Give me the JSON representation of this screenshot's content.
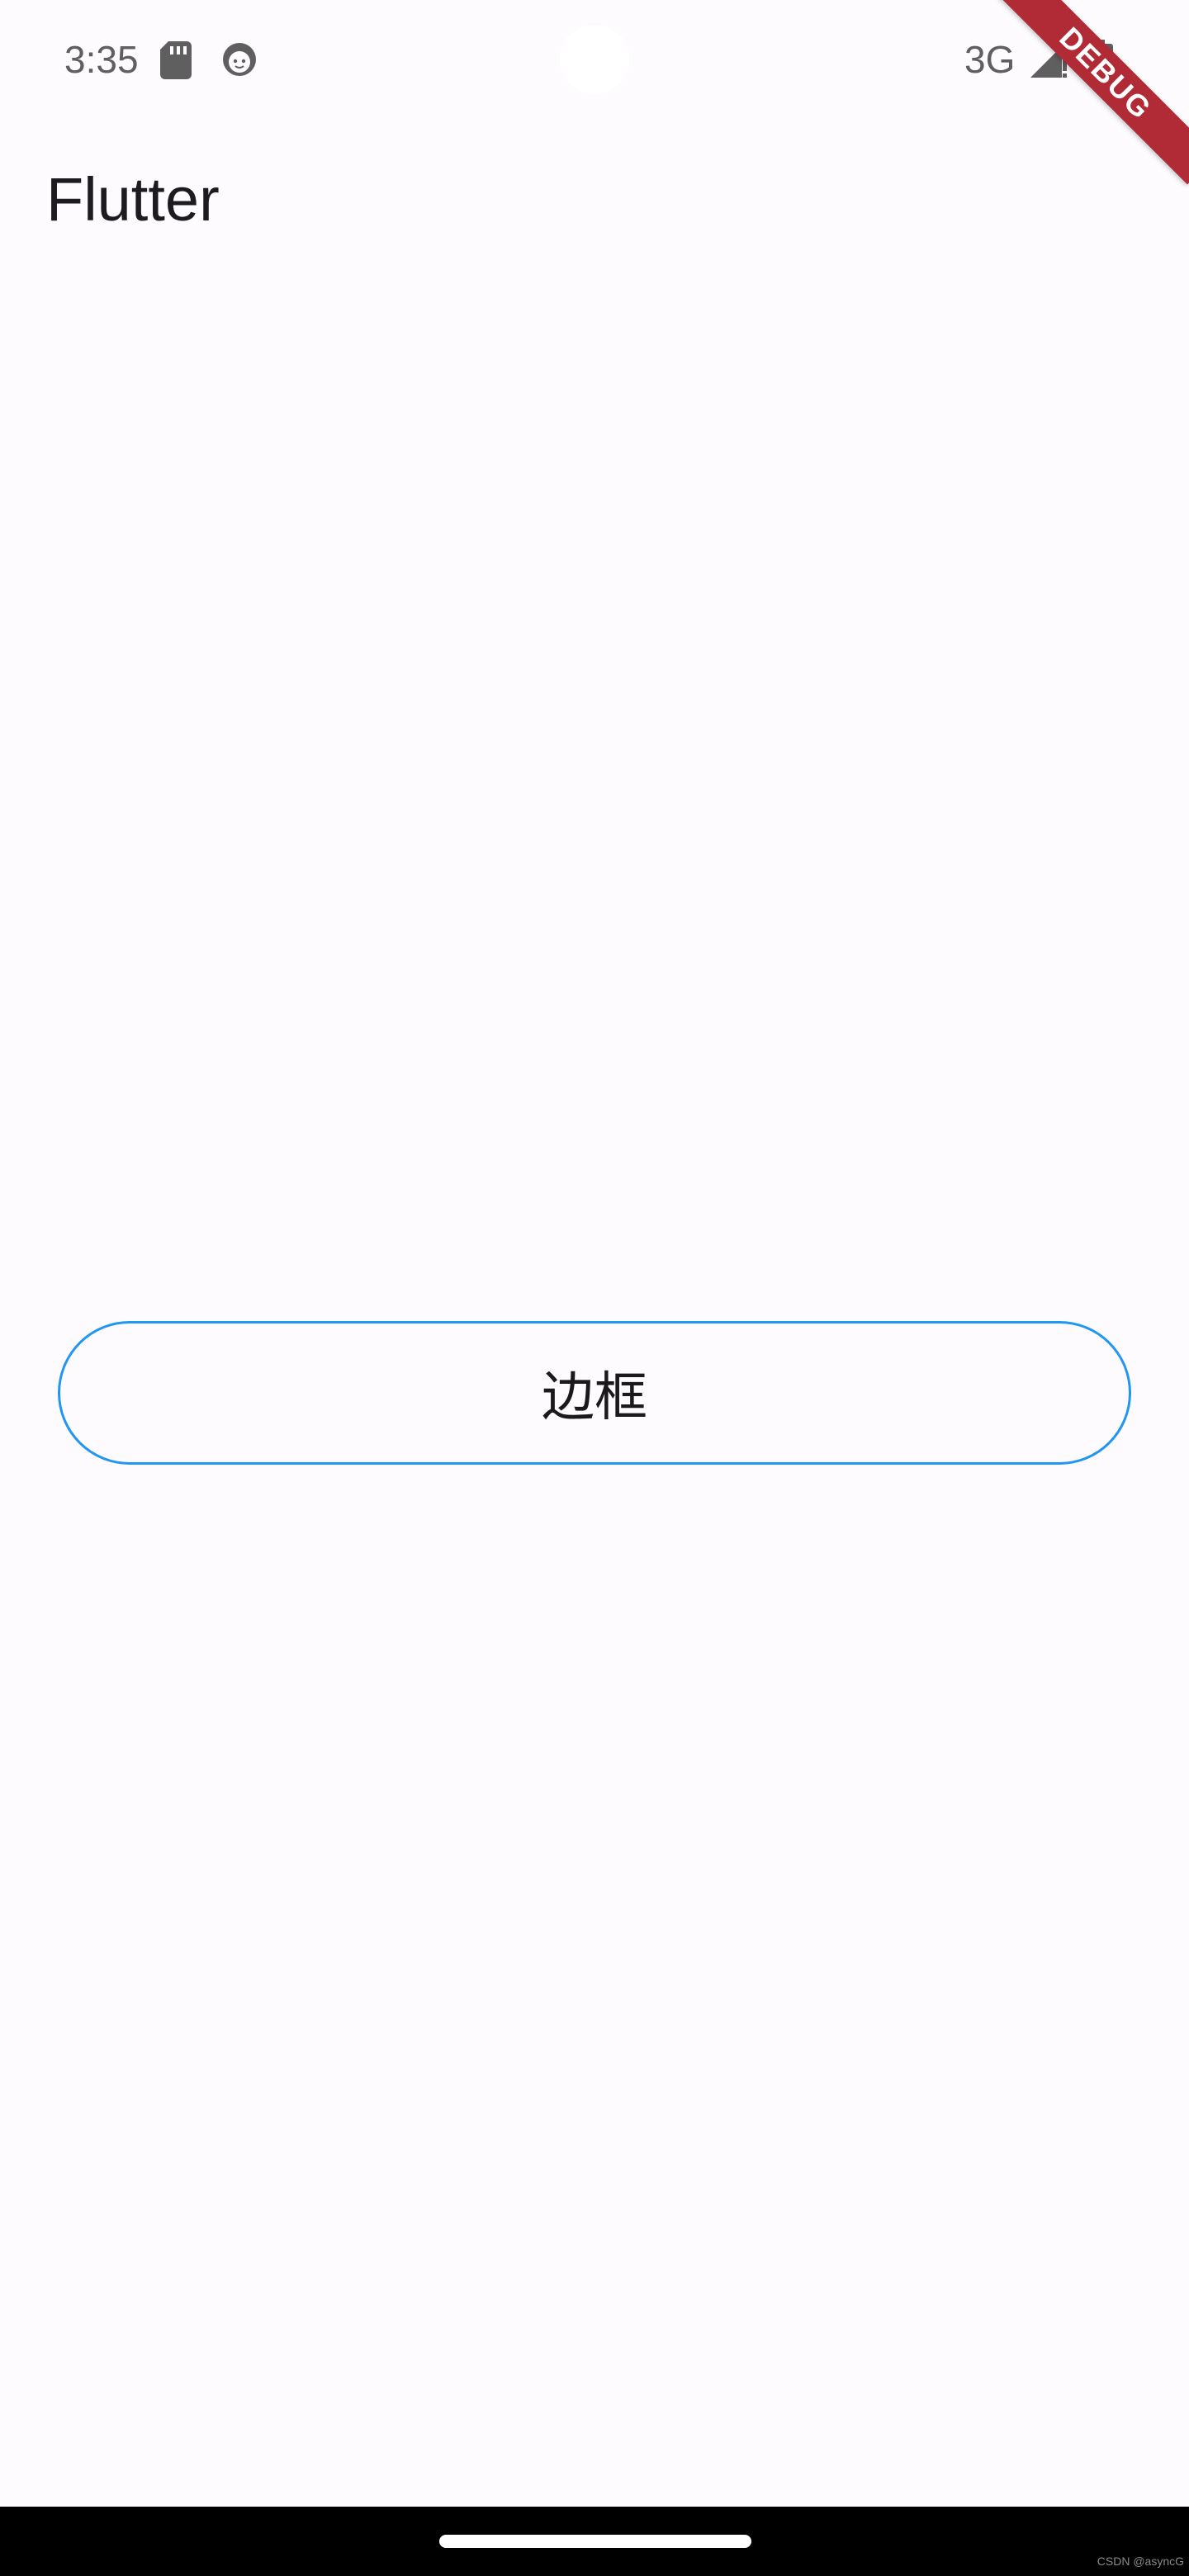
{
  "status_bar": {
    "time": "3:35",
    "network": "3G",
    "icons": [
      "sd-card-icon",
      "face-icon",
      "signal-icon",
      "battery-icon"
    ]
  },
  "debug_banner": {
    "label": "DEBUG",
    "color": "#b02b35"
  },
  "app_bar": {
    "title": "Flutter"
  },
  "main": {
    "button_label": "边框",
    "button_border_color": "#2196f3"
  },
  "watermark": {
    "text": "CSDN @asyncG"
  },
  "colors": {
    "background": "#fefbfe",
    "nav_bar": "#000000"
  }
}
